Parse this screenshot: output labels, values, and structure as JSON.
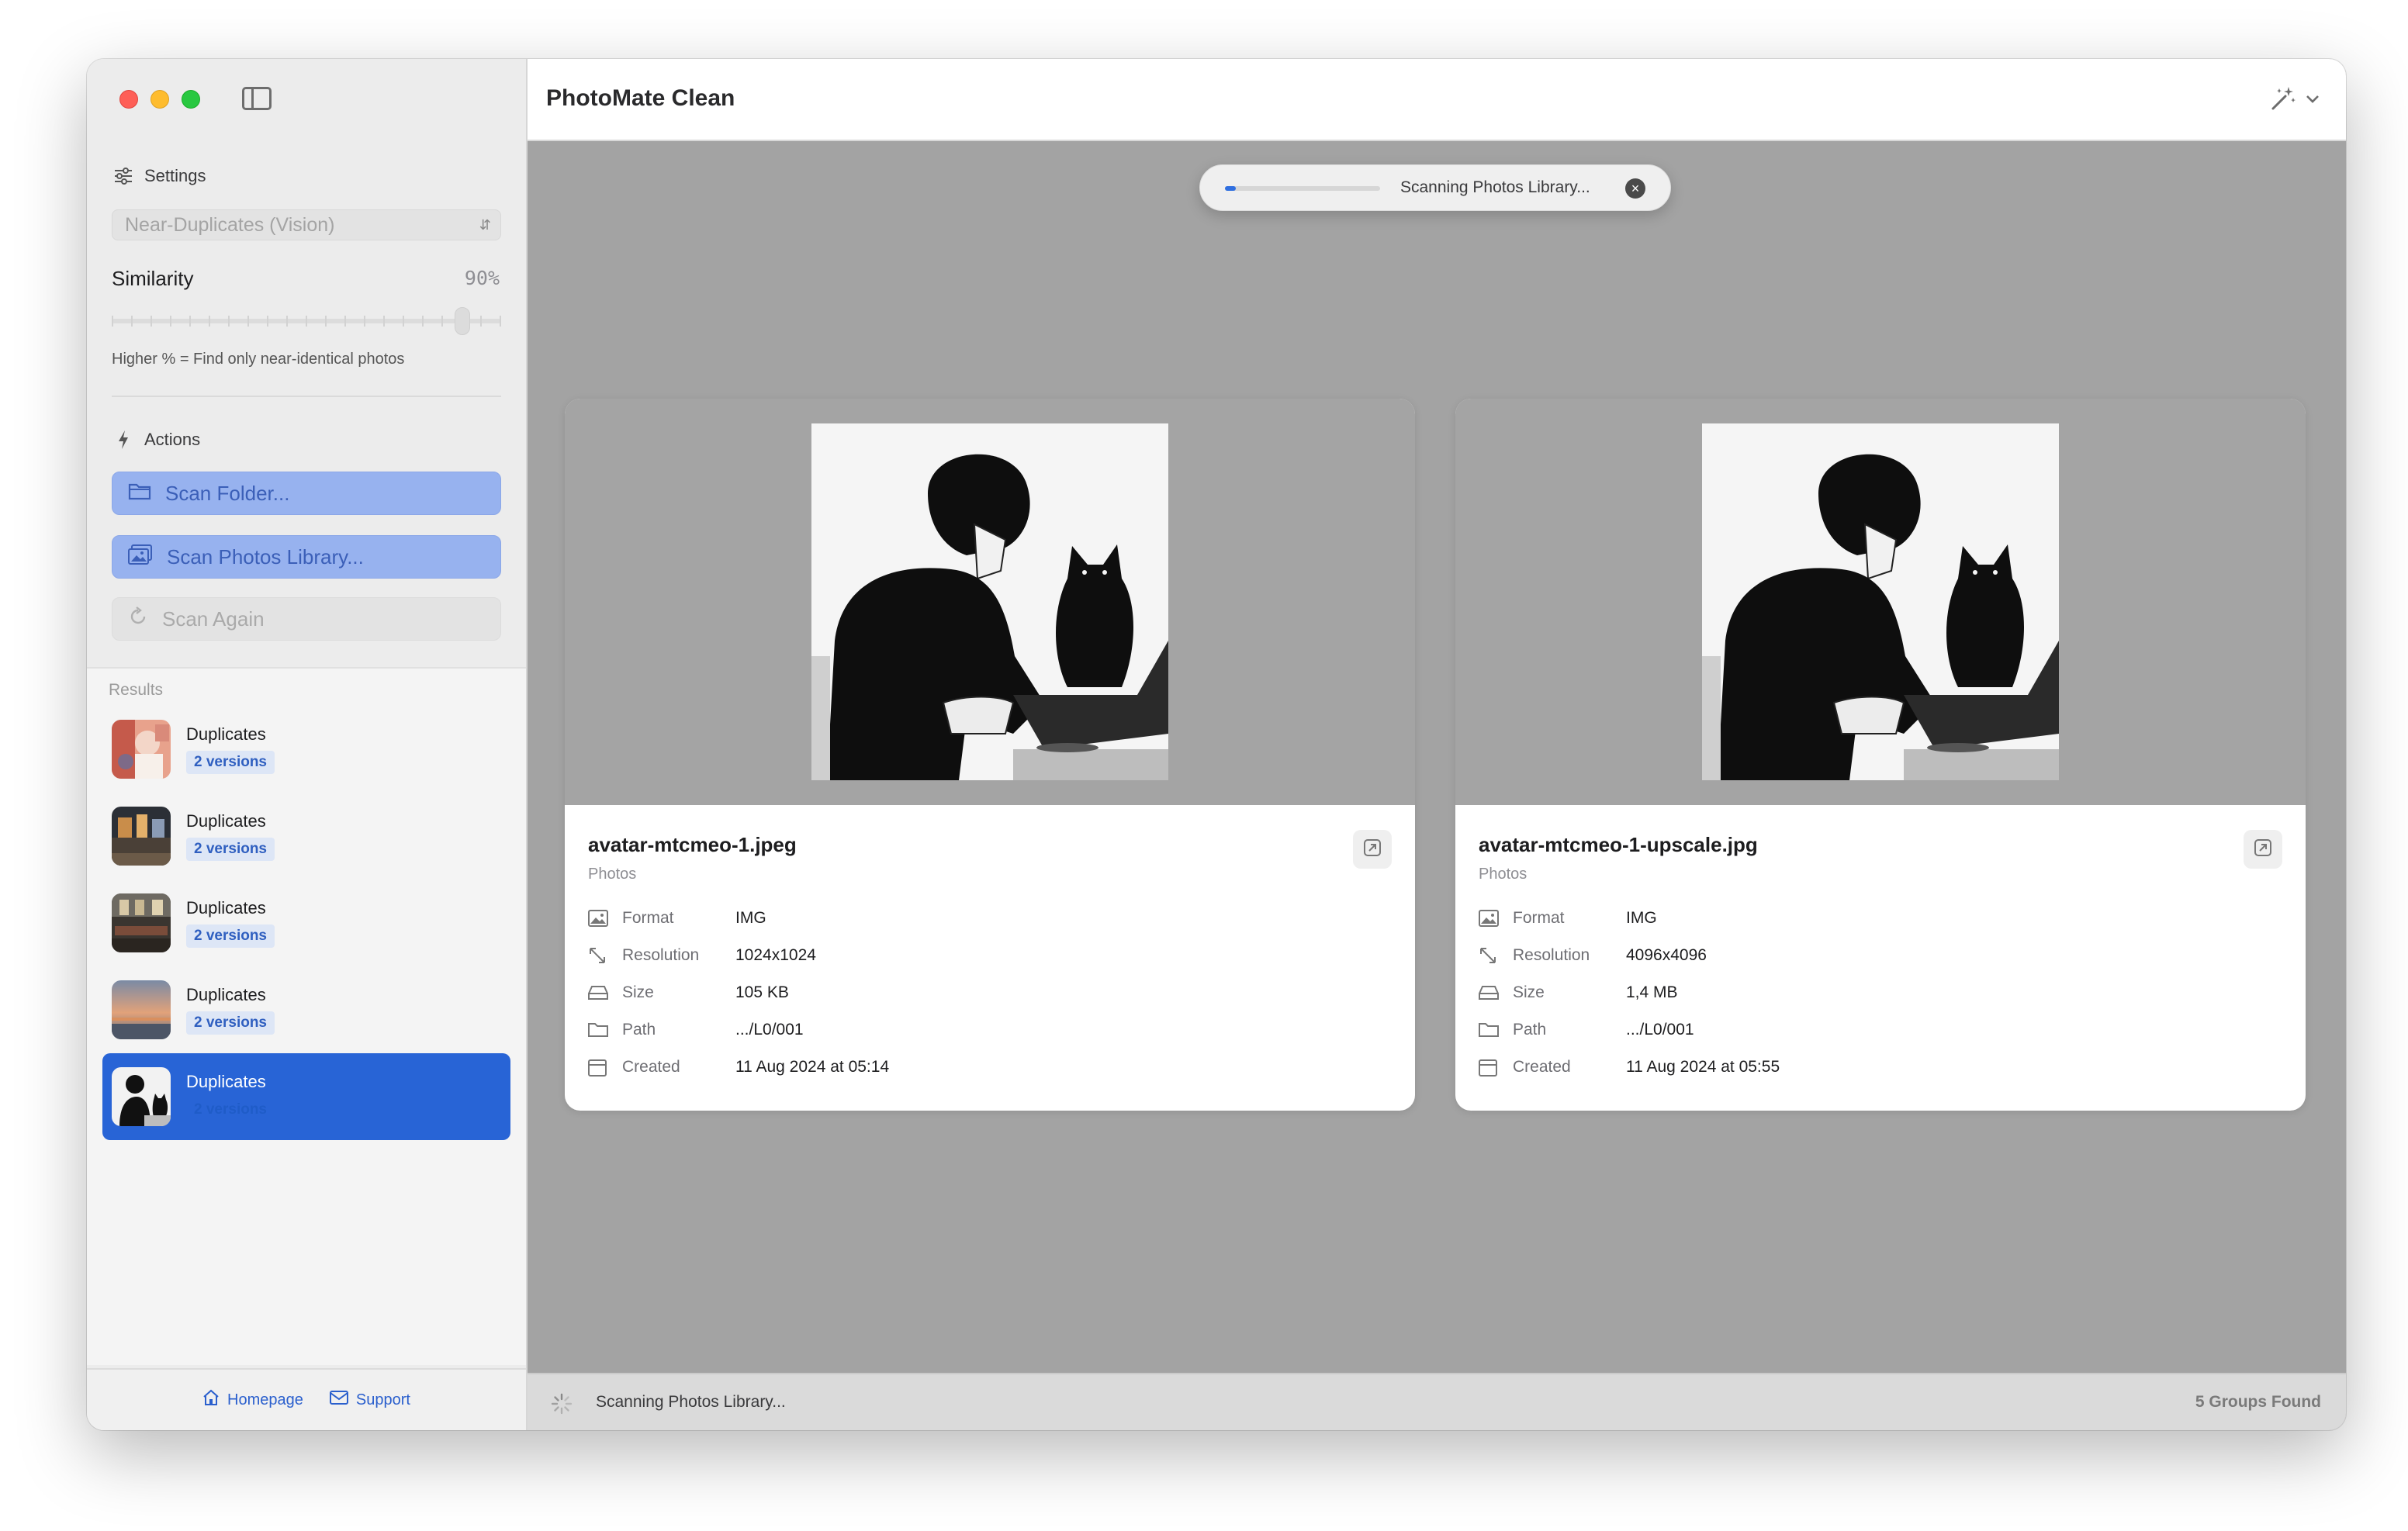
{
  "app": {
    "title": "PhotoMate Clean"
  },
  "settings": {
    "heading": "Settings",
    "mode_value": "Near-Duplicates (Vision)",
    "similarity_label": "Similarity",
    "similarity_display": "90%",
    "similarity_level": 0.9,
    "hint": "Higher % = Find only near-identical photos"
  },
  "actions": {
    "heading": "Actions",
    "scan_folder": "Scan Folder...",
    "scan_library": "Scan Photos Library...",
    "scan_again": "Scan Again"
  },
  "results": {
    "heading": "Results",
    "items": [
      {
        "title": "Duplicates",
        "badge": "2 versions"
      },
      {
        "title": "Duplicates",
        "badge": "2 versions"
      },
      {
        "title": "Duplicates",
        "badge": "2 versions"
      },
      {
        "title": "Duplicates",
        "badge": "2 versions"
      },
      {
        "title": "Duplicates",
        "badge": "2 versions"
      }
    ]
  },
  "footer": {
    "homepage": "Homepage",
    "support": "Support"
  },
  "progress": {
    "text": "Scanning Photos Library...",
    "fraction": 0.07
  },
  "cards": [
    {
      "name": "avatar-mtcmeo-1.jpeg",
      "source": "Photos",
      "meta": [
        {
          "key": "Format",
          "value": "IMG"
        },
        {
          "key": "Resolution",
          "value": "1024x1024"
        },
        {
          "key": "Size",
          "value": "105 KB"
        },
        {
          "key": "Path",
          "value": ".../L0/001"
        },
        {
          "key": "Created",
          "value": "11 Aug 2024 at 05:14"
        }
      ]
    },
    {
      "name": "avatar-mtcmeo-1-upscale.jpg",
      "source": "Photos",
      "meta": [
        {
          "key": "Format",
          "value": "IMG"
        },
        {
          "key": "Resolution",
          "value": "4096x4096"
        },
        {
          "key": "Size",
          "value": "1,4 MB"
        },
        {
          "key": "Path",
          "value": ".../L0/001"
        },
        {
          "key": "Created",
          "value": "11 Aug 2024 at 05:55"
        }
      ]
    }
  ],
  "status": {
    "text": "Scanning Photos Library...",
    "count": "5 Groups Found"
  },
  "colors": {
    "accent": "#2864d6",
    "button_blue": "#97b2ef",
    "main_bg": "#a3a3a3"
  }
}
